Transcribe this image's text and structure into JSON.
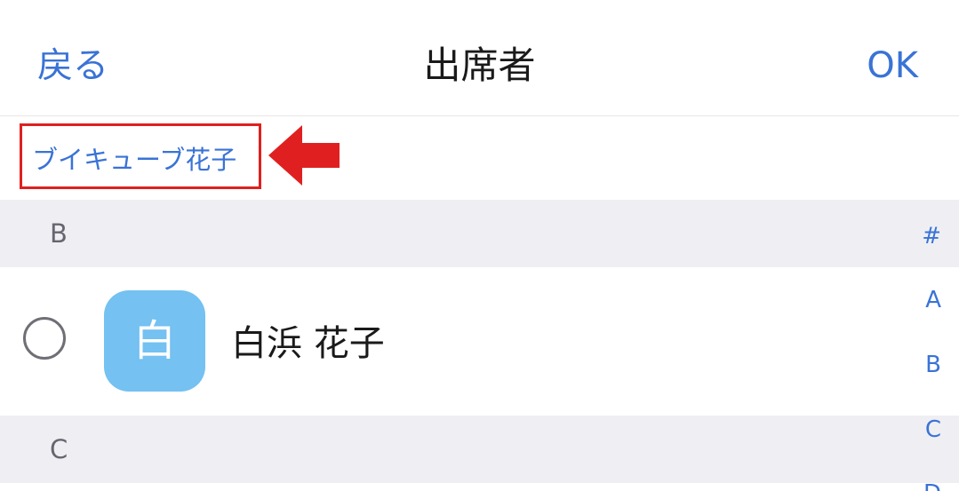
{
  "nav": {
    "back_label": "戻る",
    "title": "出席者",
    "ok_label": "OK"
  },
  "selected": {
    "names": [
      "ブイキューブ花子"
    ]
  },
  "sections": [
    {
      "letter": "B",
      "contacts": [
        {
          "avatar_char": "白",
          "name": "白浜 花子",
          "checked": false
        }
      ]
    },
    {
      "letter": "C",
      "contacts": []
    }
  ],
  "index_letters": [
    "#",
    "A",
    "B",
    "C",
    "D"
  ],
  "colors": {
    "accent": "#3a73d6",
    "highlight_red": "#e02020",
    "avatar_bg": "#74c1f2",
    "section_bg": "#efeff3"
  }
}
